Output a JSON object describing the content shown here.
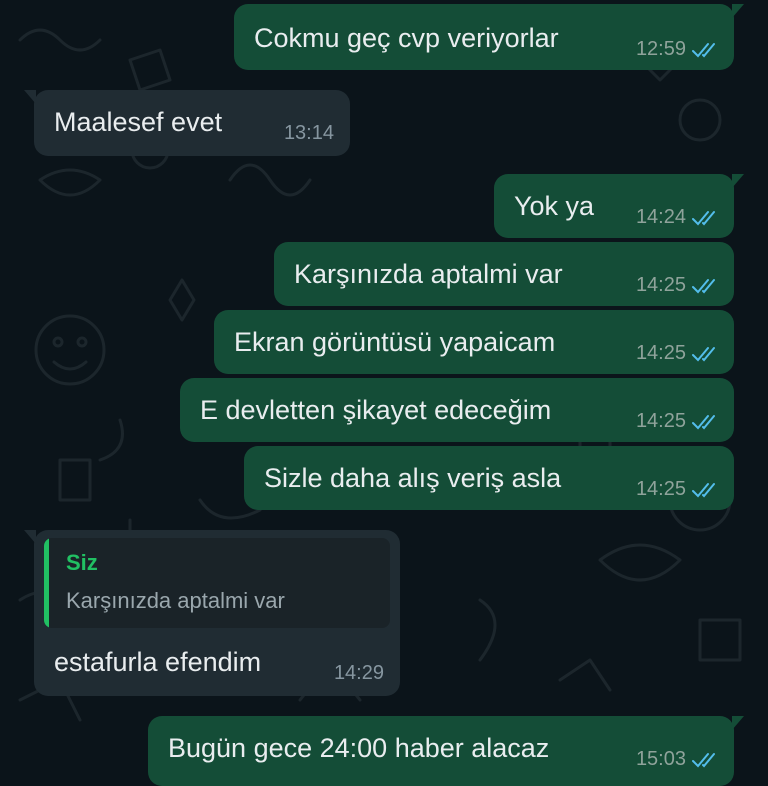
{
  "colors": {
    "background": "#0b141a",
    "outgoing_bubble": "#144d37",
    "incoming_bubble": "#202c33",
    "read_ticks": "#53bdeb",
    "quote_author": "#21c063"
  },
  "messages": [
    {
      "direction": "out",
      "text": "Cokmu geç cvp veriyorlar",
      "time": "12:59",
      "status": "read"
    },
    {
      "direction": "in",
      "text": "Maalesef evet",
      "time": "13:14"
    },
    {
      "direction": "out",
      "text": "Yok ya",
      "time": "14:24",
      "status": "read"
    },
    {
      "direction": "out",
      "text": "Karşınızda aptalmi var",
      "time": "14:25",
      "status": "read"
    },
    {
      "direction": "out",
      "text": "Ekran görüntüsü yapaicam",
      "time": "14:25",
      "status": "read"
    },
    {
      "direction": "out",
      "text": "E devletten şikayet edeceğim",
      "time": "14:25",
      "status": "read"
    },
    {
      "direction": "out",
      "text": "Sizle daha alış veriş asla",
      "time": "14:25",
      "status": "read"
    },
    {
      "direction": "in",
      "reply": {
        "author": "Siz",
        "text": "Karşınızda aptalmi var"
      },
      "text": "estafurla efendim",
      "time": "14:29"
    },
    {
      "direction": "out",
      "text": "Bugün gece 24:00 haber alacaz",
      "time": "15:03",
      "status": "read"
    }
  ]
}
